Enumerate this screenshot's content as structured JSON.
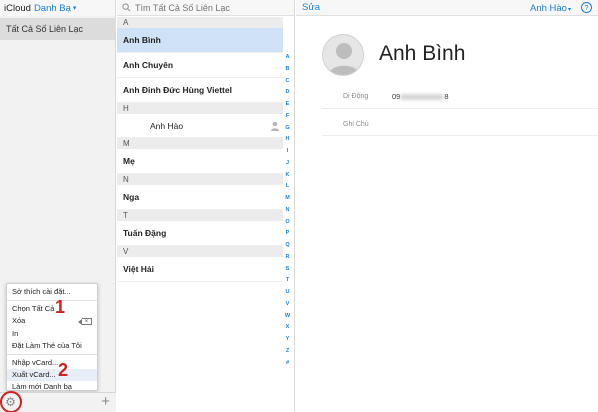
{
  "header": {
    "app_name": "iCloud",
    "section_name": "Danh Bạ",
    "search_placeholder": "Tìm Tất Cả Số Liên Lạc",
    "edit_label": "Sửa",
    "user_name": "Anh Hào",
    "help_label": "?"
  },
  "sidebar": {
    "group_all": "Tất Cả Số Liên Lạc"
  },
  "settings_menu": {
    "items": [
      "Sở thích cài đặt...",
      "Chọn Tất Cả",
      "Xóa",
      "In",
      "Đặt Làm Thẻ của Tôi",
      "Nhập vCard...",
      "Xuất vCard...",
      "Làm mới Danh bạ"
    ],
    "step_markers": [
      "1",
      "2"
    ]
  },
  "contacts": {
    "sections": [
      {
        "letter": "A",
        "names": [
          "Anh Bình",
          "Anh Chuyên",
          "Anh Đinh Đức Hùng Viettel"
        ]
      },
      {
        "letter": "H",
        "names": [
          "Anh Hào"
        ]
      },
      {
        "letter": "M",
        "names": [
          "Mẹ"
        ]
      },
      {
        "letter": "N",
        "names": [
          "Nga"
        ]
      },
      {
        "letter": "T",
        "names": [
          "Tuấn Đặng"
        ]
      },
      {
        "letter": "V",
        "names": [
          "Việt Hải"
        ]
      }
    ],
    "alphabet_index": [
      "A",
      "B",
      "C",
      "D",
      "E",
      "F",
      "G",
      "H",
      "I",
      "J",
      "K",
      "L",
      "M",
      "N",
      "O",
      "P",
      "Q",
      "R",
      "S",
      "T",
      "U",
      "V",
      "W",
      "X",
      "Y",
      "Z",
      "#"
    ]
  },
  "detail": {
    "name": "Anh Bình",
    "phone_label": "Di Động",
    "phone_prefix": "09",
    "phone_suffix": "8",
    "notes_label": "Ghi Chú"
  },
  "colors": {
    "accent": "#1a7fe3",
    "selected_row": "#cfe2f7",
    "annotation_red": "#d21f1f"
  }
}
